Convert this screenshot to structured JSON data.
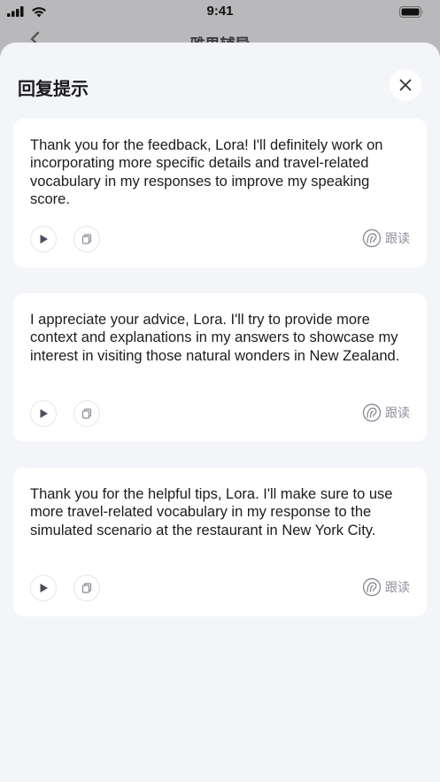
{
  "status_bar": {
    "time": "9:41"
  },
  "behind": {
    "title": "雅思辅导"
  },
  "sheet": {
    "title": "回复提示"
  },
  "cards": [
    {
      "text": "Thank you for the feedback, Lora! I'll definitely work on incorporating more specific details and travel-related vocabulary in my responses to improve my speaking score.",
      "follow_label": "跟读"
    },
    {
      "text": "I appreciate your advice, Lora. I'll try to provide more context and explanations in my answers to showcase my interest in visiting those natural wonders in New Zealand.",
      "follow_label": "跟读"
    },
    {
      "text": "Thank you for the helpful tips, Lora. I'll make sure to use more travel-related vocabulary in my response to the simulated scenario at the restaurant in New York City.",
      "follow_label": "跟读"
    }
  ],
  "colors": {
    "sheet_bg": "#f4f5f9",
    "card_bg": "#ffffff",
    "muted": "#8e8f9c"
  },
  "icons": [
    "signal-icon",
    "wifi-icon",
    "battery-icon",
    "close-icon",
    "play-icon",
    "copy-icon",
    "follow-read-icon"
  ]
}
